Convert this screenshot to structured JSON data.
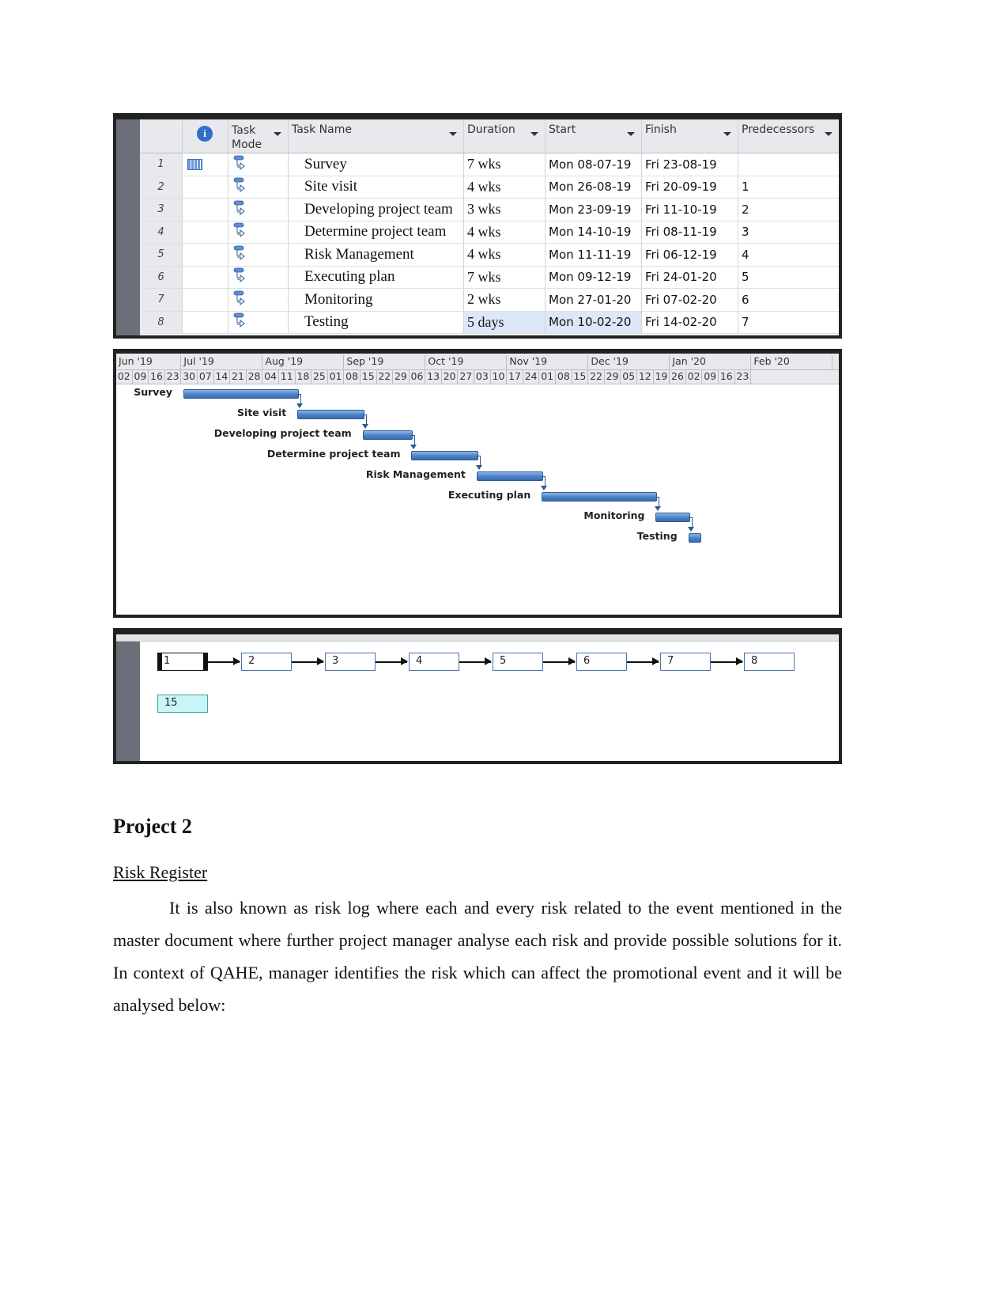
{
  "task_table": {
    "headers": {
      "id": "",
      "info": "i",
      "task_mode": "Task Mode",
      "task_name": "Task Name",
      "duration": "Duration",
      "start": "Start",
      "finish": "Finish",
      "predecessors": "Predecessors"
    },
    "rows": [
      {
        "id": "1",
        "name": "Survey",
        "duration": "7 wks",
        "start": "Mon 08-07-19",
        "finish": "Fri 23-08-19",
        "predecessors": ""
      },
      {
        "id": "2",
        "name": "Site visit",
        "duration": "4 wks",
        "start": "Mon 26-08-19",
        "finish": "Fri 20-09-19",
        "predecessors": "1"
      },
      {
        "id": "3",
        "name": "Developing project team",
        "duration": "3 wks",
        "start": "Mon 23-09-19",
        "finish": "Fri 11-10-19",
        "predecessors": "2"
      },
      {
        "id": "4",
        "name": "Determine project team",
        "duration": "4 wks",
        "start": "Mon 14-10-19",
        "finish": "Fri 08-11-19",
        "predecessors": "3"
      },
      {
        "id": "5",
        "name": "Risk Management",
        "duration": "4 wks",
        "start": "Mon 11-11-19",
        "finish": "Fri 06-12-19",
        "predecessors": "4"
      },
      {
        "id": "6",
        "name": "Executing plan",
        "duration": "7 wks",
        "start": "Mon 09-12-19",
        "finish": "Fri 24-01-20",
        "predecessors": "5"
      },
      {
        "id": "7",
        "name": "Monitoring",
        "duration": "2 wks",
        "start": "Mon 27-01-20",
        "finish": "Fri 07-02-20",
        "predecessors": "6"
      },
      {
        "id": "8",
        "name": "Testing",
        "duration": "5 days",
        "start": "Mon 10-02-20",
        "finish": "Fri 14-02-20",
        "predecessors": "7"
      }
    ]
  },
  "gantt": {
    "months": [
      {
        "label": "Jun '19",
        "weeks": 4
      },
      {
        "label": "Jul '19",
        "weeks": 5
      },
      {
        "label": "Aug '19",
        "weeks": 5
      },
      {
        "label": "Sep '19",
        "weeks": 5
      },
      {
        "label": "Oct '19",
        "weeks": 5
      },
      {
        "label": "Nov '19",
        "weeks": 5
      },
      {
        "label": "Dec '19",
        "weeks": 5
      },
      {
        "label": "Jan '20",
        "weeks": 5
      },
      {
        "label": "Feb '20",
        "weeks": 5
      }
    ],
    "weeks": [
      "02",
      "09",
      "16",
      "23",
      "30",
      "07",
      "14",
      "21",
      "28",
      "04",
      "11",
      "18",
      "25",
      "01",
      "08",
      "15",
      "22",
      "29",
      "06",
      "13",
      "20",
      "27",
      "03",
      "10",
      "17",
      "24",
      "01",
      "08",
      "15",
      "22",
      "29",
      "05",
      "12",
      "19",
      "26",
      "02",
      "09",
      "16",
      "23"
    ],
    "tasks": [
      {
        "label": "Survey",
        "start_week": 5.1,
        "weeks": 7
      },
      {
        "label": "Site visit",
        "start_week": 12.1,
        "weeks": 4
      },
      {
        "label": "Developing project team",
        "start_week": 16.1,
        "weeks": 3
      },
      {
        "label": "Determine project team",
        "start_week": 19.1,
        "weeks": 4
      },
      {
        "label": "Risk Management",
        "start_week": 23.1,
        "weeks": 4
      },
      {
        "label": "Executing plan",
        "start_week": 27.1,
        "weeks": 7
      },
      {
        "label": "Monitoring",
        "start_week": 34.1,
        "weeks": 2
      },
      {
        "label": "Testing",
        "start_week": 36.1,
        "weeks": 0.7
      }
    ]
  },
  "network": {
    "nodes": [
      "1",
      "2",
      "3",
      "4",
      "5",
      "6",
      "7",
      "8"
    ],
    "legend_node": "15"
  },
  "document": {
    "heading": "Project 2",
    "subheading": "Risk Register",
    "paragraph": "It is also known as risk log where each and every risk related to the event mentioned in the master document where further project manager analyse each risk and provide possible solutions for it. In context of QAHE, manager identifies the risk which can affect the promotional event and it will be analysed below:"
  }
}
